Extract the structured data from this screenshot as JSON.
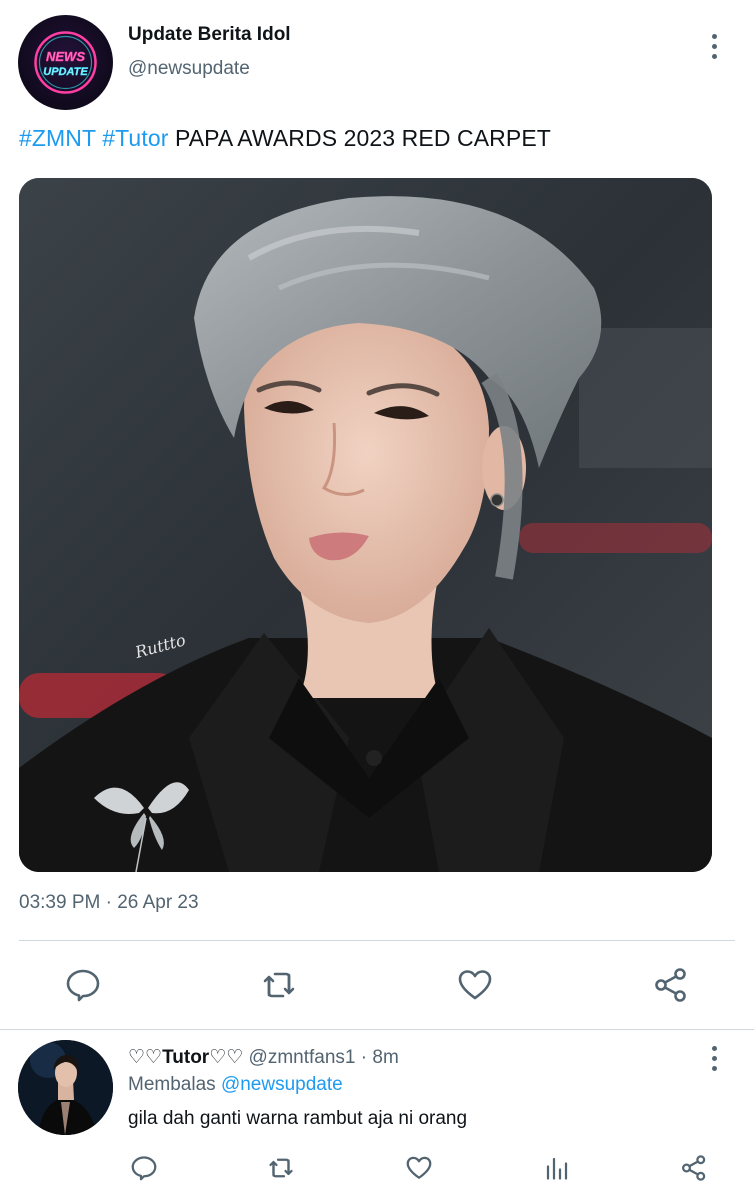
{
  "tweet": {
    "author": {
      "display_name": "Update Berita Idol",
      "handle": "@newsupdate",
      "avatar_text_top": "NEWS",
      "avatar_text_bottom": "UPDATE"
    },
    "text": {
      "hashtags": [
        "#ZMNT",
        "#Tutor"
      ],
      "body": "PAPA AWARDS 2023 RED CARPET"
    },
    "photo": {
      "signature": "Ruttto"
    },
    "timestamp": "03:39 PM · 26 Apr 23",
    "actions": {
      "reply_icon": "speech-bubble-icon",
      "retweet_icon": "retweet-icon",
      "like_icon": "heart-icon",
      "share_icon": "share-icon"
    }
  },
  "reply": {
    "display_name": "♡♡Tutor♡♡",
    "handle": "@zmntfans1",
    "separator": "·",
    "time": "8m",
    "replying_label": "Membalas",
    "replying_handle": "@newsupdate",
    "text": "gila dah ganti warna rambut aja ni orang",
    "actions": {
      "reply_icon": "speech-bubble-icon",
      "retweet_icon": "retweet-icon",
      "like_icon": "heart-icon",
      "views_icon": "bar-chart-icon",
      "share_icon": "share-icon"
    }
  },
  "colors": {
    "accent": "#1d9bf0",
    "text_primary": "#0f1419",
    "text_secondary": "#536471",
    "divider": "#cfd9de",
    "neon_pink": "#ff3fa4",
    "neon_cyan": "#3fe6ff"
  }
}
